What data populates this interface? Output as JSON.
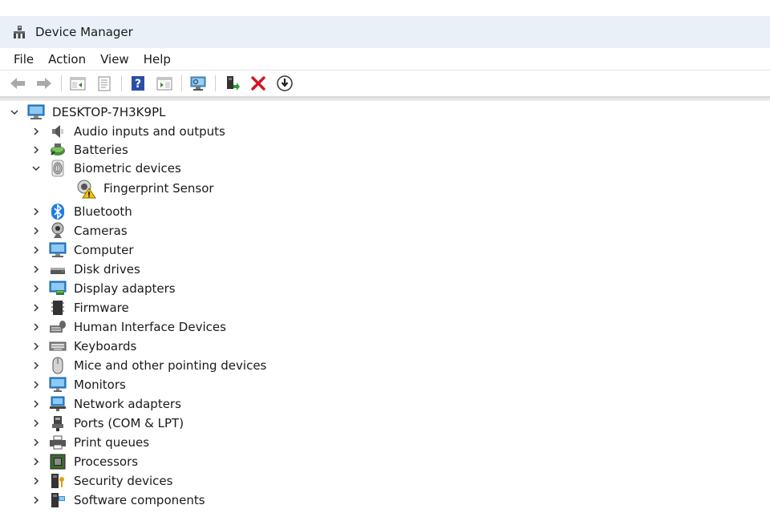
{
  "window": {
    "title": "Device Manager",
    "icon": "device-manager-icon"
  },
  "menu": [
    "File",
    "Action",
    "View",
    "Help"
  ],
  "toolbar": [
    {
      "name": "back-icon"
    },
    {
      "name": "forward-icon"
    },
    {
      "sep": true
    },
    {
      "name": "show-hide-console-tree-icon"
    },
    {
      "name": "properties-icon"
    },
    {
      "sep": true
    },
    {
      "name": "help-icon"
    },
    {
      "name": "action-pane-icon"
    },
    {
      "sep": true
    },
    {
      "name": "scan-hardware-icon"
    },
    {
      "sep": true
    },
    {
      "name": "update-driver-icon"
    },
    {
      "name": "uninstall-device-icon"
    },
    {
      "name": "disable-device-icon"
    }
  ],
  "tree": {
    "root": "DESKTOP-7H3K9PL",
    "categories": [
      {
        "label": "Audio inputs and outputs",
        "icon": "speaker-icon"
      },
      {
        "label": "Batteries",
        "icon": "battery-icon"
      },
      {
        "label": "Biometric devices",
        "icon": "fingerprint-icon",
        "expanded": true,
        "children": [
          {
            "label": "Fingerprint Sensor",
            "icon": "fingerprint-sensor-warning-icon"
          }
        ]
      },
      {
        "label": "Bluetooth",
        "icon": "bluetooth-icon"
      },
      {
        "label": "Cameras",
        "icon": "camera-icon"
      },
      {
        "label": "Computer",
        "icon": "computer-icon"
      },
      {
        "label": "Disk drives",
        "icon": "disk-drive-icon"
      },
      {
        "label": "Display adapters",
        "icon": "display-adapter-icon"
      },
      {
        "label": "Firmware",
        "icon": "firmware-icon"
      },
      {
        "label": "Human Interface Devices",
        "icon": "hid-icon"
      },
      {
        "label": "Keyboards",
        "icon": "keyboard-icon"
      },
      {
        "label": "Mice and other pointing devices",
        "icon": "mouse-icon"
      },
      {
        "label": "Monitors",
        "icon": "monitor-icon"
      },
      {
        "label": "Network adapters",
        "icon": "network-adapter-icon"
      },
      {
        "label": "Ports (COM & LPT)",
        "icon": "port-icon"
      },
      {
        "label": "Print queues",
        "icon": "printer-icon"
      },
      {
        "label": "Processors",
        "icon": "processor-icon"
      },
      {
        "label": "Security devices",
        "icon": "security-device-icon"
      },
      {
        "label": "Software components",
        "icon": "software-component-icon"
      }
    ]
  }
}
